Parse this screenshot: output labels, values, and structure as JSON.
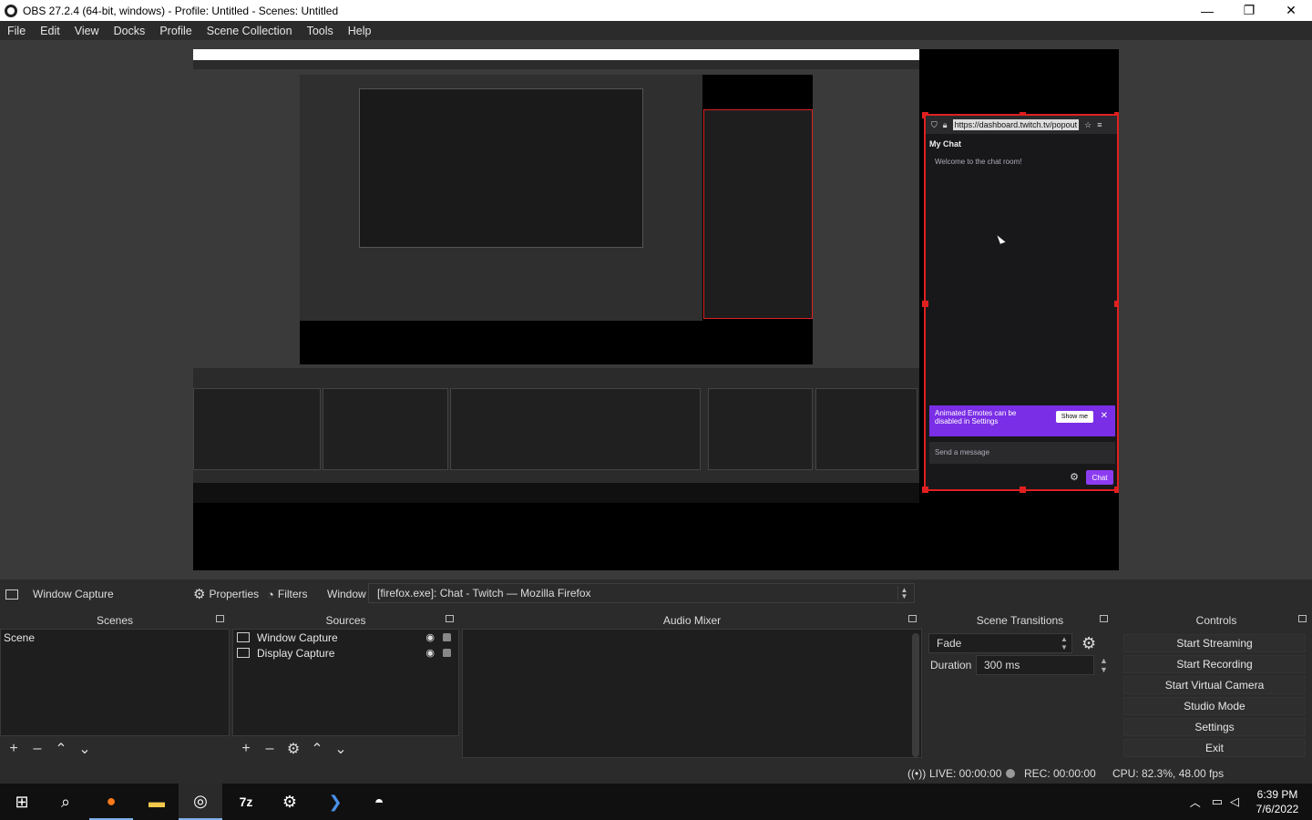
{
  "window": {
    "title": "OBS 27.2.4 (64-bit, windows) - Profile: Untitled - Scenes: Untitled",
    "minimize": "—",
    "restore": "❐",
    "close": "✕"
  },
  "menu": [
    "File",
    "Edit",
    "View",
    "Docks",
    "Profile",
    "Scene Collection",
    "Tools",
    "Help"
  ],
  "preview": {
    "chat": {
      "url": "https://dashboard.twitch.tv/popout",
      "header": "My Chat",
      "welcome": "Welcome to the chat room!",
      "promo_text_line1": "Animated Emotes can be",
      "promo_text_line2": "disabled in Settings",
      "show_me": "Show me",
      "promo_close": "✕",
      "input_placeholder": "Send a message",
      "chat_button": "Chat"
    }
  },
  "source_toolbar": {
    "source_name": "Window Capture",
    "properties": "Properties",
    "filters": "Filters",
    "window_label": "Window",
    "window_value": "[firefox.exe]: Chat - Twitch — Mozilla Firefox"
  },
  "scenes": {
    "title": "Scenes",
    "items": [
      "Scene"
    ]
  },
  "sources": {
    "title": "Sources",
    "items": [
      "Window Capture",
      "Display Capture"
    ]
  },
  "audio_mixer": {
    "title": "Audio Mixer"
  },
  "transitions": {
    "title": "Scene Transitions",
    "type": "Fade",
    "duration_label": "Duration",
    "duration_value": "300 ms"
  },
  "controls": {
    "title": "Controls",
    "buttons": [
      "Start Streaming",
      "Start Recording",
      "Start Virtual Camera",
      "Studio Mode",
      "Settings",
      "Exit"
    ]
  },
  "status": {
    "live": "LIVE: 00:00:00",
    "rec": "REC: 00:00:00",
    "cpu": "CPU: 82.3%, 48.00 fps"
  },
  "taskbar": {
    "time": "6:39 PM",
    "date": "7/6/2022"
  },
  "colors": {
    "selection_red": "#e02020",
    "twitch_purple": "#7a2ee6",
    "taskbar_accent": "#7fb0e8"
  }
}
